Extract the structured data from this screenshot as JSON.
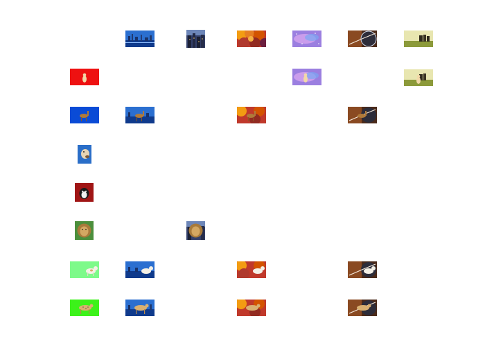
{
  "figure": {
    "grid": {
      "rows": [
        {
          "label": "",
          "cells": [
            "",
            "city",
            "city-night",
            "colorful",
            "galaxy",
            "space",
            "field"
          ]
        },
        {
          "label": "red-bg-dog",
          "cells": [
            "red",
            "",
            "",
            "",
            "galaxy-dog",
            "",
            "field-dog"
          ]
        },
        {
          "label": "blue-bg-deer",
          "cells": [
            "blue",
            "city-deer",
            "",
            "colorful-deer",
            "",
            "space-deer",
            ""
          ]
        },
        {
          "label": "dog-portrait",
          "cells": [
            "dog-portrait",
            "",
            "",
            "",
            "",
            "",
            ""
          ]
        },
        {
          "label": "dog-portrait-red",
          "cells": [
            "dog-red",
            "",
            "",
            "",
            "",
            "",
            ""
          ]
        },
        {
          "label": "lion",
          "cells": [
            "lion",
            "",
            "city-lion",
            "",
            "",
            "",
            ""
          ]
        },
        {
          "label": "green-dog",
          "cells": [
            "lightgreen-dog",
            "city-dog",
            "",
            "colorful-dog",
            "",
            "space-dog",
            ""
          ]
        },
        {
          "label": "green-cheetah",
          "cells": [
            "green-cheetah",
            "city-cheetah",
            "",
            "colorful-cheetah",
            "",
            "space-cheetah",
            ""
          ]
        }
      ]
    }
  }
}
